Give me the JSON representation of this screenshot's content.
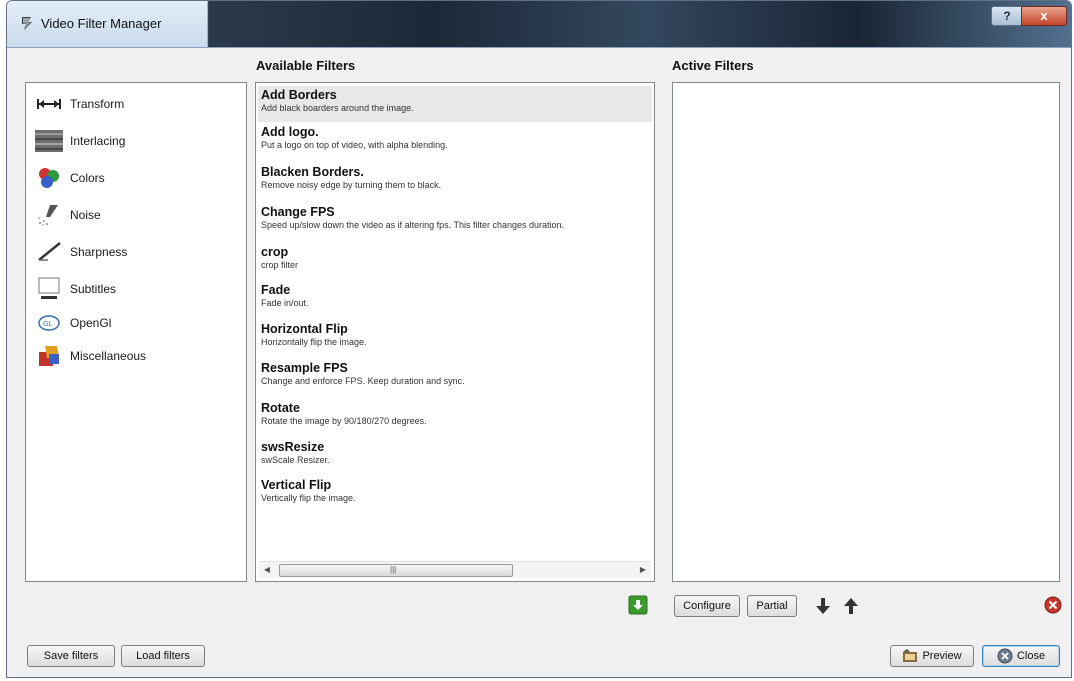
{
  "window": {
    "title": "Video Filter Manager"
  },
  "titlebar": {
    "help_label": "?",
    "close_label": "x"
  },
  "headings": {
    "available": "Available Filters",
    "active": "Active Filters"
  },
  "categories": [
    {
      "label": "Transform",
      "icon": "transform-icon"
    },
    {
      "label": "Interlacing",
      "icon": "interlacing-icon"
    },
    {
      "label": "Colors",
      "icon": "colors-icon"
    },
    {
      "label": "Noise",
      "icon": "noise-icon"
    },
    {
      "label": "Sharpness",
      "icon": "sharpness-icon"
    },
    {
      "label": "Subtitles",
      "icon": "subtitles-icon"
    },
    {
      "label": "OpenGl",
      "icon": "opengl-icon"
    },
    {
      "label": "Miscellaneous",
      "icon": "miscellaneous-icon"
    }
  ],
  "filters": [
    {
      "name": "Add Borders",
      "desc": "Add black boarders around the image."
    },
    {
      "name": "Add logo.",
      "desc": "Put a logo on top of video, with alpha blending."
    },
    {
      "name": "Blacken Borders.",
      "desc": "Remove noisy edge by turning them to black."
    },
    {
      "name": "Change FPS",
      "desc": "Speed up/slow down the video as if altering fps. This filter changes duration."
    },
    {
      "name": "crop",
      "desc": "crop filter"
    },
    {
      "name": "Fade",
      "desc": "Fade in/out."
    },
    {
      "name": "Horizontal Flip",
      "desc": "Horizontally flip the image."
    },
    {
      "name": "Resample FPS",
      "desc": "Change and enforce FPS. Keep duration and sync."
    },
    {
      "name": "Rotate",
      "desc": "Rotate the image by 90/180/270 degrees."
    },
    {
      "name": "swsResize",
      "desc": "swScale Resizer."
    },
    {
      "name": "Vertical Flip",
      "desc": "Vertically flip the image."
    }
  ],
  "scrollbar": {
    "grip": "|||"
  },
  "buttons": {
    "configure": "Configure",
    "partial": "Partial",
    "save_filters": "Save filters",
    "load_filters": "Load filters",
    "preview": "Preview",
    "close": "Close"
  },
  "colors": {
    "add_green": "#3a9a2a",
    "remove_red": "#c8352a",
    "selection": "#e8e8e8"
  }
}
